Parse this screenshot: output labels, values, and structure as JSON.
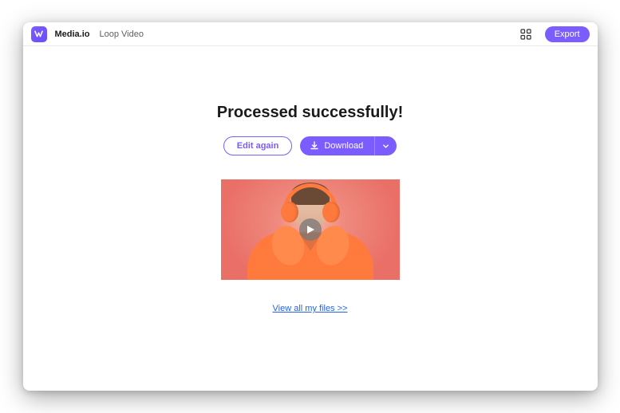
{
  "header": {
    "brand": "Media.io",
    "tool": "Loop Video",
    "export_label": "Export"
  },
  "main": {
    "title": "Processed successfully!",
    "edit_label": "Edit again",
    "download_label": "Download",
    "view_files_label": "View all my files >>"
  },
  "icons": {
    "logo": "m-badge",
    "grid": "grid-icon",
    "download": "download-icon",
    "chevron_down": "chevron-down-icon",
    "play": "play-icon"
  },
  "colors": {
    "accent": "#7b5cff",
    "link": "#2563eb"
  }
}
